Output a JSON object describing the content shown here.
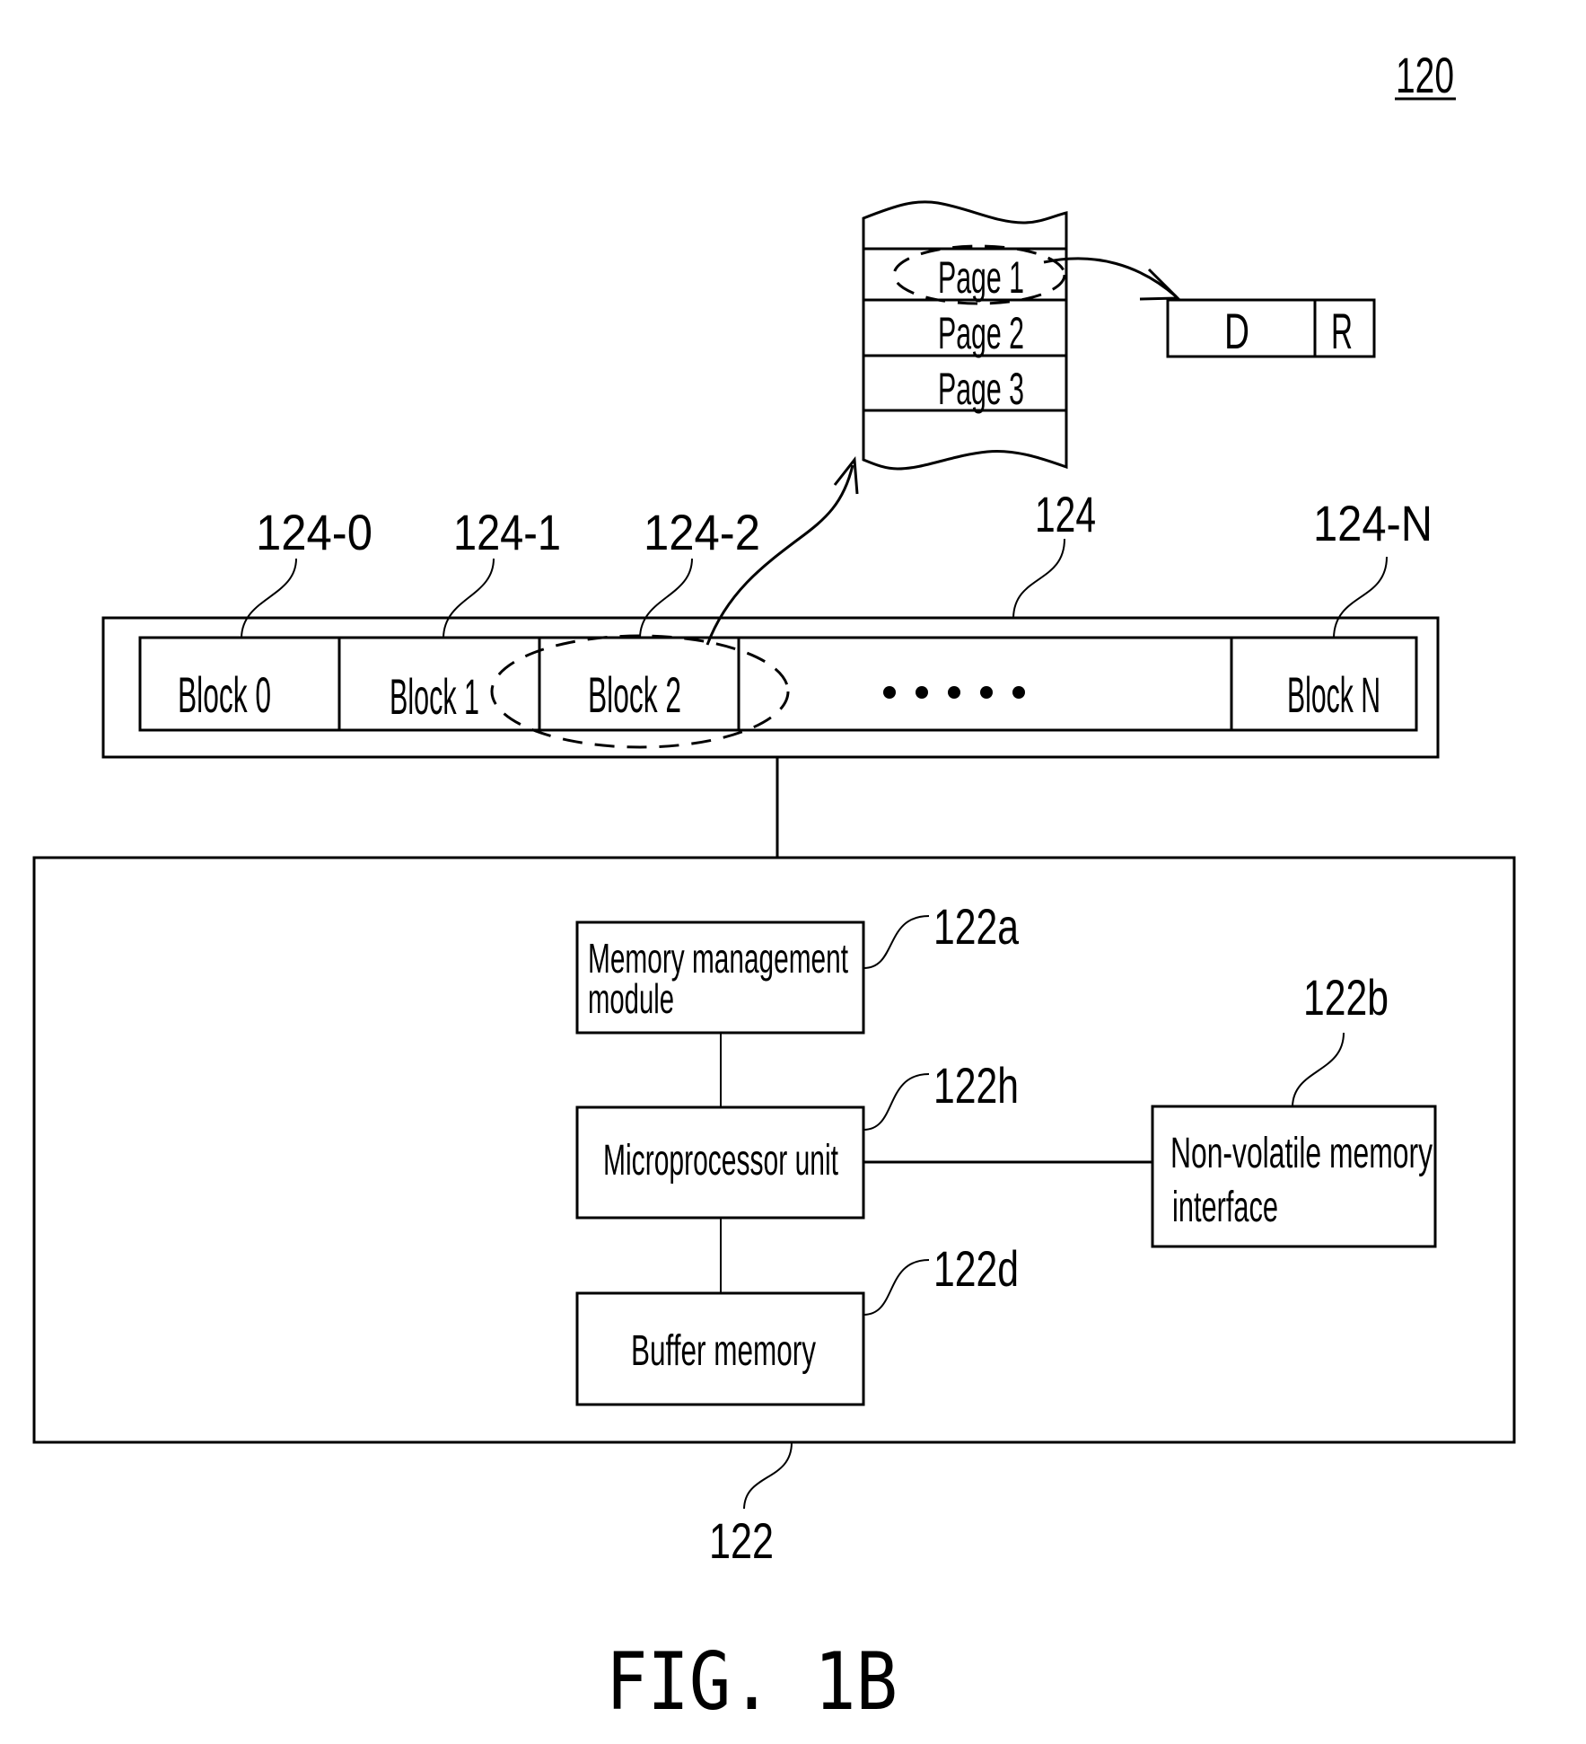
{
  "figure": {
    "title": "FIG. 1B",
    "ref_main": "120"
  },
  "memory_array": {
    "ref": "124",
    "blocks": [
      {
        "label": "Block 0",
        "ref": "124-0"
      },
      {
        "label": "Block 1",
        "ref": "124-1"
      },
      {
        "label": "Block 2",
        "ref": "124-2"
      },
      {
        "label": "Block N",
        "ref": "124-N"
      }
    ],
    "ellipsis": "•••••"
  },
  "page_stack": {
    "pages": [
      "Page 1",
      "Page 2",
      "Page 3"
    ]
  },
  "page_fields": {
    "data": "D",
    "redundancy": "R"
  },
  "controller": {
    "ref": "122",
    "modules": {
      "memory_management": {
        "line1": "Memory management",
        "line2": "module",
        "ref": "122a"
      },
      "microprocessor": {
        "label": "Microprocessor unit",
        "ref": "122h"
      },
      "buffer": {
        "label": "Buffer memory",
        "ref": "122d"
      },
      "nvm_interface": {
        "line1": "Non-volatile memory",
        "line2": "interface",
        "ref": "122b"
      }
    }
  }
}
